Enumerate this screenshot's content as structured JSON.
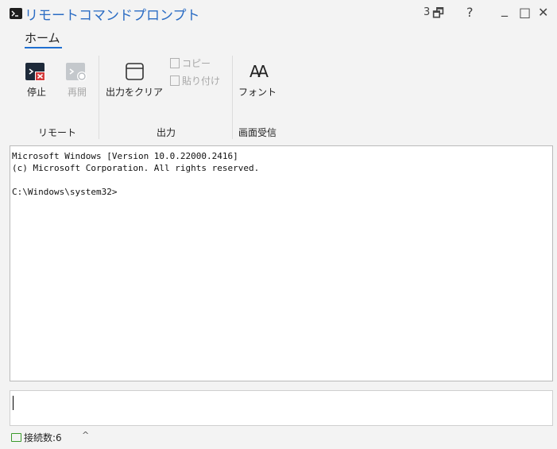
{
  "window": {
    "title": "リモートコマンドプロンプト",
    "controls": {
      "count": "3",
      "restore": "🗗",
      "help": "?",
      "minimize": "_",
      "maximize": "□",
      "close": "✕"
    }
  },
  "tabs": [
    {
      "label": "ホーム",
      "active": true
    }
  ],
  "ribbon": {
    "groups": {
      "remote": "リモート",
      "output": "出力",
      "screen": "画面受信"
    },
    "buttons": {
      "stop": "停止",
      "resume": "再開",
      "clear_output": "出力をクリア",
      "copy": "コピー",
      "paste": "貼り付け",
      "font": "フォント",
      "font_glyph": "AA"
    }
  },
  "console": {
    "lines": [
      "Microsoft Windows [Version 10.0.22000.2416]",
      "(c) Microsoft Corporation. All rights reserved.",
      "",
      "C:\\Windows\\system32>"
    ]
  },
  "input": {
    "value": ""
  },
  "status": {
    "connections": "接続数:6",
    "chevron": "^"
  },
  "colors": {
    "accent": "#1f6fd1",
    "title": "#2b6cc4",
    "stop_red": "#d43c3c",
    "status_green": "#3a9a2b"
  }
}
